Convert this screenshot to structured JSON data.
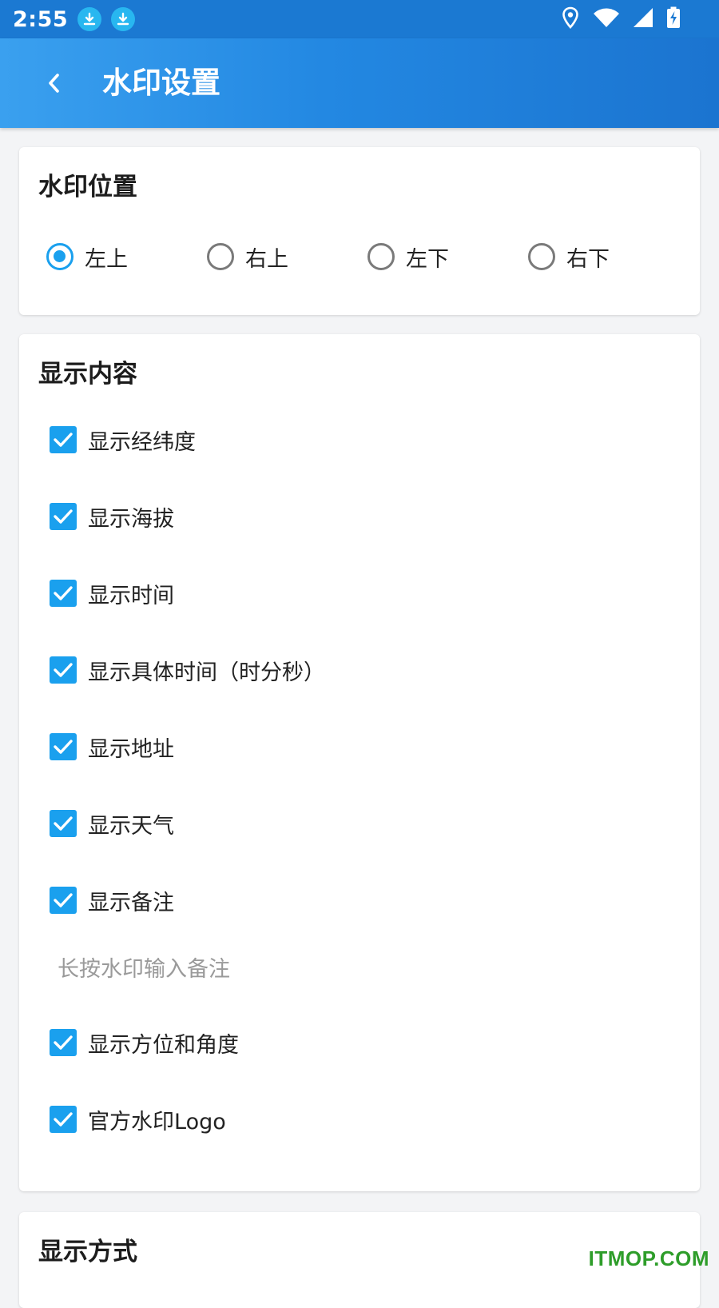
{
  "status_bar": {
    "time": "2:55",
    "left_icons": [
      "download-icon",
      "download-icon"
    ],
    "right_icons": [
      "location-icon",
      "wifi-icon",
      "signal-icon",
      "battery-charging-icon"
    ]
  },
  "app_bar": {
    "title": "水印设置",
    "back_icon": "chevron-left-icon",
    "gradient": [
      "#3aa0ef",
      "#1b74d0"
    ]
  },
  "position_card": {
    "title": "水印位置",
    "options": [
      {
        "label": "左上",
        "selected": true
      },
      {
        "label": "右上",
        "selected": false
      },
      {
        "label": "左下",
        "selected": false
      },
      {
        "label": "右下",
        "selected": false
      }
    ]
  },
  "content_card": {
    "title": "显示内容",
    "items": [
      {
        "label": "显示经纬度",
        "checked": true
      },
      {
        "label": "显示海拔",
        "checked": true
      },
      {
        "label": "显示时间",
        "checked": true
      },
      {
        "label": "显示具体时间（时分秒）",
        "checked": true
      },
      {
        "label": "显示地址",
        "checked": true
      },
      {
        "label": "显示天气",
        "checked": true
      },
      {
        "label": "显示备注",
        "checked": true
      }
    ],
    "note_hint": "长按水印输入备注",
    "items_after": [
      {
        "label": "显示方位和角度",
        "checked": true
      },
      {
        "label": "官方水印Logo",
        "checked": true
      }
    ]
  },
  "display_card": {
    "title": "显示方式"
  },
  "watermark_text": "ITMOP.COM",
  "colors": {
    "accent": "#1aa0ee",
    "status_bar": "#1b79d2",
    "background": "#f3f4f6",
    "watermark": "#2e9d2a"
  }
}
